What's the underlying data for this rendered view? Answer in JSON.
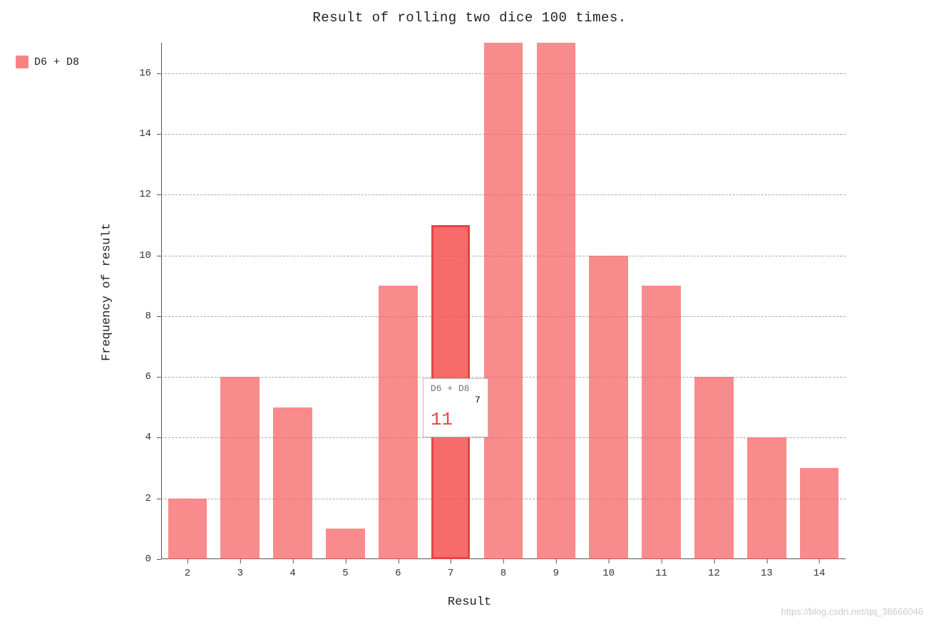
{
  "chart_data": {
    "type": "bar",
    "title": "Result of rolling two dice 100 times.",
    "xlabel": "Result",
    "ylabel": "Frequency of result",
    "categories": [
      2,
      3,
      4,
      5,
      6,
      7,
      8,
      9,
      10,
      11,
      12,
      13,
      14
    ],
    "series": [
      {
        "name": "D6 + D8",
        "values": [
          2,
          6,
          5,
          1,
          9,
          11,
          17,
          17,
          10,
          9,
          6,
          4,
          3
        ]
      }
    ],
    "ylim": [
      0,
      17
    ],
    "yticks": [
      0,
      2,
      4,
      6,
      8,
      10,
      12,
      14,
      16
    ],
    "hover": {
      "category": 7,
      "series": "D6 + D8",
      "value": 11
    },
    "legend_position": "left"
  },
  "watermark": "https://blog.csdn.net/qq_38666046"
}
